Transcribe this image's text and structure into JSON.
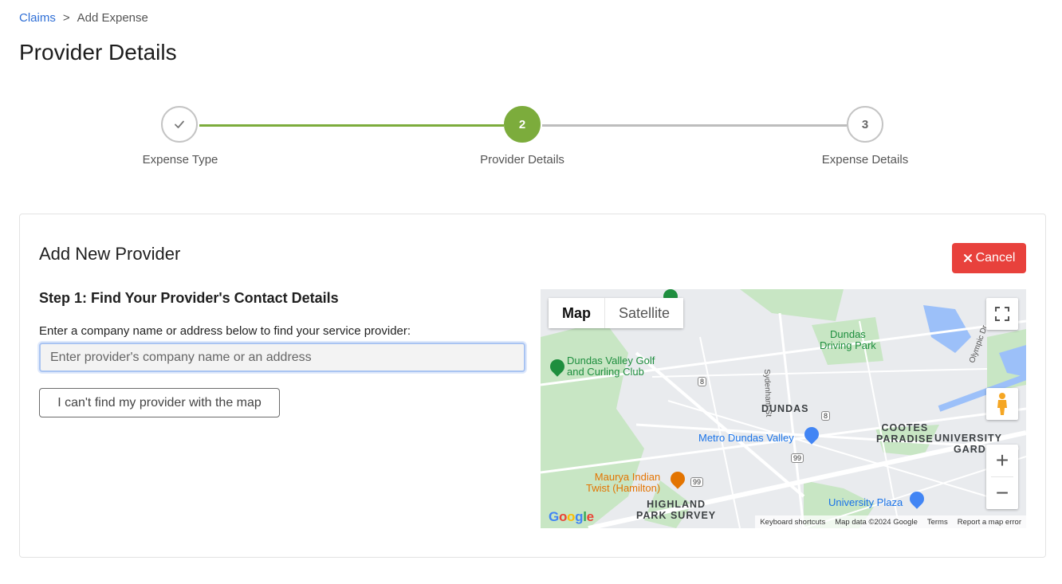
{
  "breadcrumb": {
    "root": "Claims",
    "separator": ">",
    "current": "Add Expense"
  },
  "page": {
    "title": "Provider Details"
  },
  "stepper": {
    "steps": [
      {
        "number": "",
        "label": "Expense Type",
        "status": "completed"
      },
      {
        "number": "2",
        "label": "Provider Details",
        "status": "active"
      },
      {
        "number": "3",
        "label": "Expense Details",
        "status": "pending"
      }
    ],
    "active_color": "#7cac3c"
  },
  "card": {
    "title": "Add New Provider",
    "cancel_label": "Cancel",
    "step_heading": "Step 1: Find Your Provider's Contact Details",
    "prompt": "Enter a company name or address below to find your service provider:",
    "search_value": "",
    "search_placeholder": "Enter provider's company name or an address",
    "cant_find_label": "I can't find my provider with the map"
  },
  "map": {
    "type_options": [
      "Map",
      "Satellite"
    ],
    "selected_type": "Map",
    "places": {
      "dundas_driving_park_1": "Dundas",
      "dundas_driving_park_2": "Driving Park",
      "golf_1": "Dundas Valley Golf",
      "golf_2": "and Curling Club",
      "dundas": "DUNDAS",
      "metro": "Metro Dundas Valley",
      "cootes_1": "COOTES",
      "cootes_2": "PARADISE",
      "university_1": "UNIVERSITY",
      "university_2": "GARDEN",
      "maurya_1": "Maurya Indian",
      "maurya_2": "Twist (Hamilton)",
      "highland_1": "HIGHLAND",
      "highland_2": "PARK SURVEY",
      "university_plaza": "University Plaza",
      "sydenham": "Sydenham St",
      "olympic": "Olympic Dr",
      "route_8a": "8",
      "route_8b": "8",
      "route_99a": "99",
      "route_99b": "99"
    },
    "footer": {
      "shortcuts": "Keyboard shortcuts",
      "data": "Map data ©2024 Google",
      "terms": "Terms",
      "report": "Report a map error"
    },
    "logo_letters": [
      "G",
      "o",
      "o",
      "g",
      "l",
      "e"
    ],
    "colors": {
      "water": "#9cc0f9",
      "park": "#c8e6c4",
      "road": "#ffffff",
      "base": "#e9ebee"
    }
  }
}
